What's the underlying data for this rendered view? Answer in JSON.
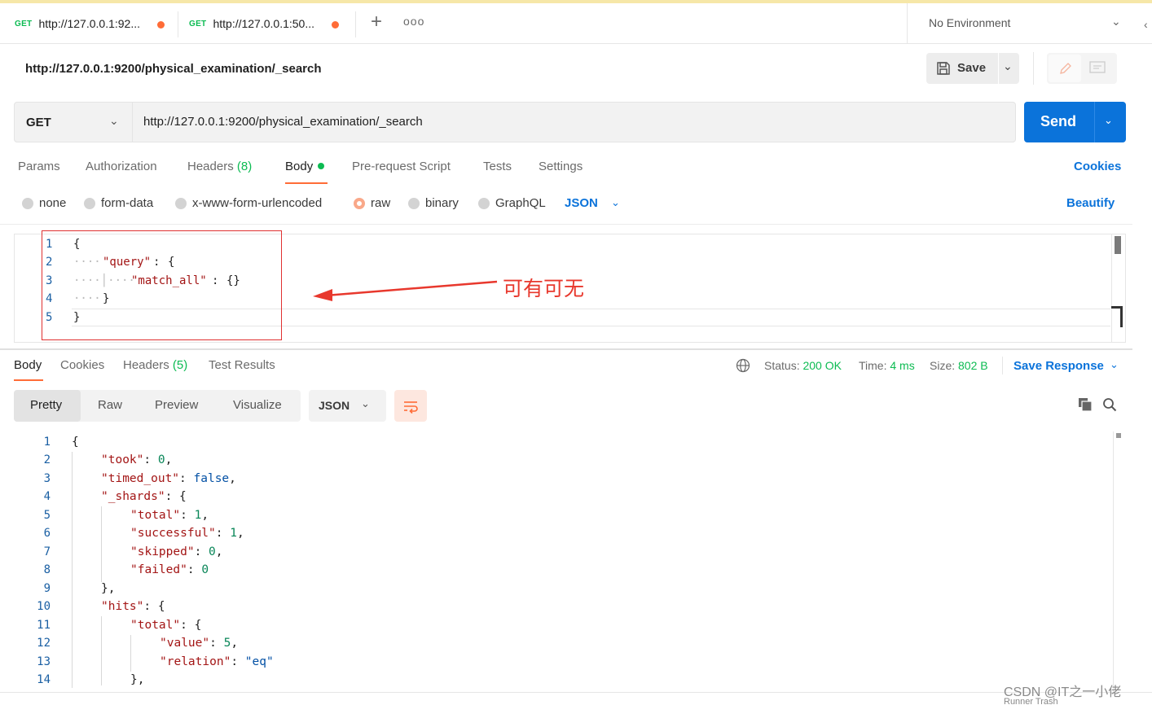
{
  "tabs": [
    {
      "method": "GET",
      "url": "http://127.0.0.1:92..."
    },
    {
      "method": "GET",
      "url": "http://127.0.0.1:50..."
    }
  ],
  "environment": "No Environment",
  "request": {
    "title": "http://127.0.0.1:9200/physical_examination/_search",
    "method": "GET",
    "url": "http://127.0.0.1:9200/physical_examination/_search",
    "save_label": "Save",
    "send_label": "Send"
  },
  "request_tabs": {
    "params": "Params",
    "authorization": "Authorization",
    "headers": "Headers",
    "headers_count": "(8)",
    "body": "Body",
    "pre_request": "Pre-request Script",
    "tests": "Tests",
    "settings": "Settings",
    "cookies": "Cookies"
  },
  "body_types": {
    "none": "none",
    "form_data": "form-data",
    "urlencoded": "x-www-form-urlencoded",
    "raw": "raw",
    "binary": "binary",
    "graphql": "GraphQL",
    "language": "JSON",
    "beautify": "Beautify",
    "selected": "raw"
  },
  "request_body": {
    "line_numbers": [
      "1",
      "2",
      "3",
      "4",
      "5"
    ],
    "open": "{",
    "query_key": "\"query\"",
    "query_open": "{",
    "match_key": "\"match_all\"",
    "match_val": "{}",
    "query_close": "}",
    "close": "}"
  },
  "annotation": "可有可无",
  "response_tabs": {
    "body": "Body",
    "cookies": "Cookies",
    "headers": "Headers",
    "headers_count": "(5)",
    "test_results": "Test Results"
  },
  "response_meta": {
    "status_label": "Status:",
    "status_value": "200 OK",
    "time_label": "Time:",
    "time_value": "4 ms",
    "size_label": "Size:",
    "size_value": "802 B",
    "save_response": "Save Response"
  },
  "view_modes": {
    "pretty": "Pretty",
    "raw": "Raw",
    "preview": "Preview",
    "visualize": "Visualize",
    "format": "JSON"
  },
  "response_body": {
    "line_numbers": [
      "1",
      "2",
      "3",
      "4",
      "5",
      "6",
      "7",
      "8",
      "9",
      "10",
      "11",
      "12",
      "13",
      "14"
    ],
    "l1": "{",
    "took_key": "\"took\"",
    "took_val": "0",
    "timed_out_key": "\"timed_out\"",
    "timed_out_val": "false",
    "shards_key": "\"_shards\"",
    "shards_open": "{",
    "total_key": "\"total\"",
    "total_val": "1",
    "successful_key": "\"successful\"",
    "successful_val": "1",
    "skipped_key": "\"skipped\"",
    "skipped_val": "0",
    "failed_key": "\"failed\"",
    "failed_val": "0",
    "shards_close": "},",
    "hits_key": "\"hits\"",
    "hits_open": "{",
    "hits_total_key": "\"total\"",
    "hits_total_open": "{",
    "value_key": "\"value\"",
    "value_val": "5",
    "relation_key": "\"relation\"",
    "relation_val": "\"eq\"",
    "hits_total_close": "},"
  },
  "watermark": "CSDN @IT之一小佬",
  "footer_text": "Runner   Trash"
}
